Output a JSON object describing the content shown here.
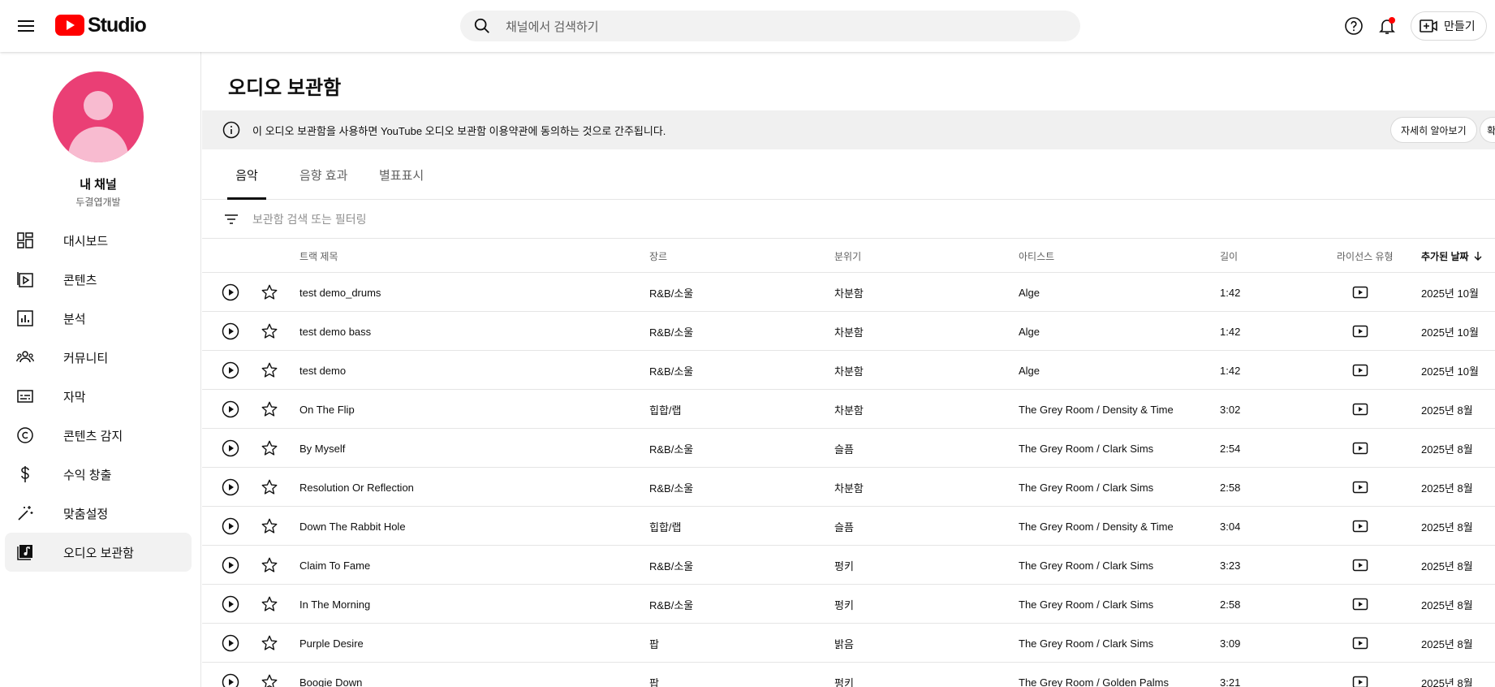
{
  "header": {
    "logo_text": "Studio",
    "search_placeholder": "채널에서 검색하기",
    "create_label": "만들기"
  },
  "sidebar": {
    "channel_name": "내 채널",
    "channel_handle": "두결엽개발",
    "items": [
      {
        "label": "대시보드",
        "icon": "dashboard-icon"
      },
      {
        "label": "콘텐츠",
        "icon": "content-icon"
      },
      {
        "label": "분석",
        "icon": "analytics-icon"
      },
      {
        "label": "커뮤니티",
        "icon": "community-icon"
      },
      {
        "label": "자막",
        "icon": "subtitles-icon"
      },
      {
        "label": "콘텐츠 감지",
        "icon": "copyright-icon"
      },
      {
        "label": "수익 창출",
        "icon": "monetization-icon"
      },
      {
        "label": "맞춤설정",
        "icon": "customization-icon"
      },
      {
        "label": "오디오 보관함",
        "icon": "audio-library-icon",
        "active": true
      }
    ]
  },
  "main": {
    "title": "오디오 보관함",
    "notice": {
      "text": "이 오디오 보관함을 사용하면 YouTube 오디오 보관함 이용약관에 동의하는 것으로 간주됩니다.",
      "learn_more": "자세히 알아보기",
      "partial_button": "확"
    },
    "tabs": [
      "음악",
      "음향 효과",
      "별표표시"
    ],
    "active_tab": 0,
    "filter_placeholder": "보관함 검색 또는 필터링",
    "columns": {
      "title": "트랙 제목",
      "genre": "장르",
      "mood": "분위기",
      "artist": "아티스트",
      "length": "길이",
      "license": "라이선스 유형",
      "added": "추가된 날짜"
    },
    "rows": [
      {
        "title": "test demo_drums",
        "genre": "R&B/소울",
        "mood": "차분함",
        "artist": "Alge",
        "length": "1:42",
        "added": "2025년 10월"
      },
      {
        "title": "test demo bass",
        "genre": "R&B/소울",
        "mood": "차분함",
        "artist": "Alge",
        "length": "1:42",
        "added": "2025년 10월"
      },
      {
        "title": "test demo",
        "genre": "R&B/소울",
        "mood": "차분함",
        "artist": "Alge",
        "length": "1:42",
        "added": "2025년 10월"
      },
      {
        "title": "On The Flip",
        "genre": "힙합/랩",
        "mood": "차분함",
        "artist": "The Grey Room / Density & Time",
        "length": "3:02",
        "added": "2025년 8월"
      },
      {
        "title": "By Myself",
        "genre": "R&B/소울",
        "mood": "슬픔",
        "artist": "The Grey Room / Clark Sims",
        "length": "2:54",
        "added": "2025년 8월"
      },
      {
        "title": "Resolution Or Reflection",
        "genre": "R&B/소울",
        "mood": "차분함",
        "artist": "The Grey Room / Clark Sims",
        "length": "2:58",
        "added": "2025년 8월"
      },
      {
        "title": "Down The Rabbit Hole",
        "genre": "힙합/랩",
        "mood": "슬픔",
        "artist": "The Grey Room / Density & Time",
        "length": "3:04",
        "added": "2025년 8월"
      },
      {
        "title": "Claim To Fame",
        "genre": "R&B/소울",
        "mood": "펑키",
        "artist": "The Grey Room / Clark Sims",
        "length": "3:23",
        "added": "2025년 8월"
      },
      {
        "title": "In The Morning",
        "genre": "R&B/소울",
        "mood": "펑키",
        "artist": "The Grey Room / Clark Sims",
        "length": "2:58",
        "added": "2025년 8월"
      },
      {
        "title": "Purple Desire",
        "genre": "팝",
        "mood": "밝음",
        "artist": "The Grey Room / Clark Sims",
        "length": "3:09",
        "added": "2025년 8월"
      },
      {
        "title": "Boogie Down",
        "genre": "팝",
        "mood": "펑키",
        "artist": "The Grey Room / Golden Palms",
        "length": "3:21",
        "added": "2025년 8월"
      }
    ]
  },
  "colors": {
    "brand_red": "#ff0000",
    "avatar_bg": "#ea3f75",
    "notification_dot": "#ff0000"
  }
}
